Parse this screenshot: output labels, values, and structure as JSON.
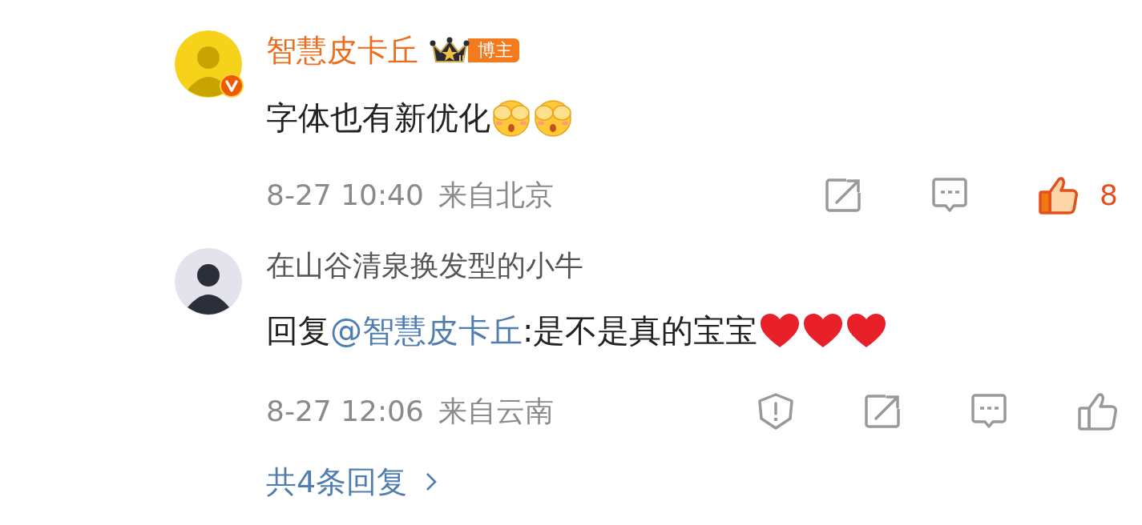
{
  "comments": [
    {
      "author": "智慧皮卡丘",
      "kind": "blogger",
      "badge": "博主",
      "avatar": {
        "color": "#f6d21a"
      },
      "verified": true,
      "text": "字体也有新优化",
      "emojis": [
        {
          "kind": "covered-face"
        },
        {
          "kind": "covered-face"
        }
      ],
      "time": "8-27 10:40",
      "location": "来自北京",
      "actions": [
        {
          "kind": "share"
        },
        {
          "kind": "comment"
        },
        {
          "kind": "like",
          "selected": true,
          "count": "8"
        }
      ]
    },
    {
      "author": "在山谷清泉换发型的小牛",
      "kind": "user",
      "avatar": {
        "color": "#e4e2ea"
      },
      "verified": false,
      "reply_prefix": "回复",
      "mention": "@智慧皮卡丘",
      "text": ":是不是真的宝宝",
      "emojis": [
        {
          "kind": "heart"
        },
        {
          "kind": "heart"
        },
        {
          "kind": "heart"
        }
      ],
      "time": "8-27 12:06",
      "location": "来自云南",
      "actions": [
        {
          "kind": "report"
        },
        {
          "kind": "share"
        },
        {
          "kind": "comment"
        },
        {
          "kind": "like",
          "selected": false
        }
      ]
    }
  ],
  "replies_link": "共4条回复"
}
